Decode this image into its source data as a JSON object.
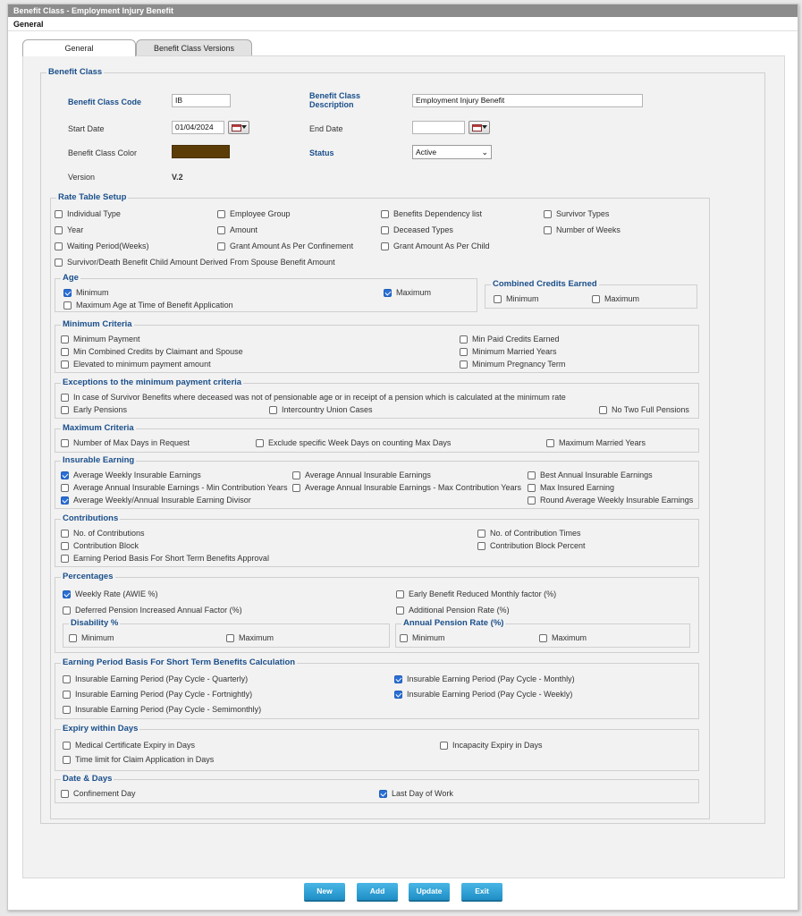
{
  "window": {
    "title": "Benefit Class - Employment Injury Benefit",
    "subtitle": "General"
  },
  "tabs": [
    {
      "label": "General",
      "active": true
    },
    {
      "label": "Benefit Class Versions",
      "active": false
    }
  ],
  "benefit_class": {
    "legend": "Benefit Class",
    "code_label": "Benefit Class Code",
    "code_value": "IB",
    "desc_label": "Benefit Class Description",
    "desc_value": "Employment Injury Benefit",
    "start_label": "Start Date",
    "start_value": "01/04/2024",
    "end_label": "End Date",
    "end_value": "",
    "color_label": "Benefit Class Color",
    "color_value": "#5c3d08",
    "status_label": "Status",
    "status_value": "Active",
    "version_label": "Version",
    "version_value": "V.2"
  },
  "rate_table": {
    "legend": "Rate Table Setup",
    "items": [
      {
        "label": "Individual Type",
        "checked": false
      },
      {
        "label": "Employee Group",
        "checked": false
      },
      {
        "label": "Benefits Dependency list",
        "checked": false
      },
      {
        "label": "Survivor Types",
        "checked": false
      },
      {
        "label": "Year",
        "checked": false
      },
      {
        "label": "Amount",
        "checked": false
      },
      {
        "label": "Deceased Types",
        "checked": false
      },
      {
        "label": "Number of Weeks",
        "checked": false
      },
      {
        "label": "Waiting Period(Weeks)",
        "checked": false
      },
      {
        "label": "Grant Amount As Per Confinement",
        "checked": false
      },
      {
        "label": "Grant Amount As Per Child",
        "checked": false
      },
      {
        "label": "Survivor/Death Benefit Child Amount Derived From Spouse Benefit Amount",
        "checked": false
      }
    ]
  },
  "age": {
    "legend": "Age",
    "items": [
      {
        "label": "Minimum",
        "checked": true
      },
      {
        "label": "Maximum",
        "checked": true
      },
      {
        "label": "Maximum Age at Time of Benefit Application",
        "checked": false
      }
    ]
  },
  "combined_credits": {
    "legend": "Combined Credits Earned",
    "items": [
      {
        "label": "Minimum",
        "checked": false
      },
      {
        "label": "Maximum",
        "checked": false
      }
    ]
  },
  "min_criteria": {
    "legend": "Minimum Criteria",
    "items": [
      {
        "label": "Minimum Payment",
        "checked": false
      },
      {
        "label": "Min Paid Credits Earned",
        "checked": false
      },
      {
        "label": "Min Combined Credits by Claimant and Spouse",
        "checked": false
      },
      {
        "label": "Minimum Married Years",
        "checked": false
      },
      {
        "label": "Elevated to minimum payment amount",
        "checked": false
      },
      {
        "label": "Minimum Pregnancy Term",
        "checked": false
      }
    ]
  },
  "exceptions": {
    "legend": "Exceptions to the minimum payment criteria",
    "items": [
      {
        "label": "In case of Survivor Benefits where deceased was not of pensionable age or in receipt of a pension which is calculated at the minimum rate",
        "checked": false
      },
      {
        "label": "Early Pensions",
        "checked": false
      },
      {
        "label": "Intercountry Union Cases",
        "checked": false
      },
      {
        "label": "No Two Full Pensions",
        "checked": false
      }
    ]
  },
  "max_criteria": {
    "legend": "Maximum Criteria",
    "items": [
      {
        "label": "Number of Max Days in Request",
        "checked": false
      },
      {
        "label": "Exclude specific Week Days on counting Max Days",
        "checked": false
      },
      {
        "label": "Maximum Married Years",
        "checked": false
      }
    ]
  },
  "insurable": {
    "legend": "Insurable Earning",
    "items": [
      {
        "label": "Average Weekly Insurable Earnings",
        "checked": true
      },
      {
        "label": "Average Annual Insurable Earnings",
        "checked": false
      },
      {
        "label": "Best Annual Insurable Earnings",
        "checked": false
      },
      {
        "label": "Average Annual Insurable Earnings - Min Contribution Years",
        "checked": false
      },
      {
        "label": "Average Annual Insurable Earnings - Max Contribution Years",
        "checked": false
      },
      {
        "label": "Max Insured Earning",
        "checked": false
      },
      {
        "label": "Average Weekly/Annual Insurable Earning Divisor",
        "checked": true
      },
      {
        "label": "Round Average Weekly Insurable Earnings",
        "checked": false
      }
    ]
  },
  "contributions": {
    "legend": "Contributions",
    "items": [
      {
        "label": "No. of Contributions",
        "checked": false
      },
      {
        "label": "No. of Contribution Times",
        "checked": false
      },
      {
        "label": "Contribution Block",
        "checked": false
      },
      {
        "label": "Contribution Block Percent",
        "checked": false
      },
      {
        "label": "Earning Period Basis For Short Term Benefits Approval",
        "checked": false
      }
    ]
  },
  "percentages": {
    "legend": "Percentages",
    "items": [
      {
        "label": "Weekly Rate (AWIE %)",
        "checked": true
      },
      {
        "label": "Early Benefit Reduced Monthly factor (%)",
        "checked": false
      },
      {
        "label": "Deferred Pension Increased Annual Factor (%)",
        "checked": false
      },
      {
        "label": "Additional Pension Rate (%)",
        "checked": false
      }
    ],
    "disability": {
      "legend": "Disability %",
      "items": [
        {
          "label": "Minimum",
          "checked": false
        },
        {
          "label": "Maximum",
          "checked": false
        }
      ]
    },
    "annual_pension": {
      "legend": "Annual Pension Rate (%)",
      "items": [
        {
          "label": "Minimum",
          "checked": false
        },
        {
          "label": "Maximum",
          "checked": false
        }
      ]
    }
  },
  "earning_period": {
    "legend": "Earning Period Basis For Short Term Benefits Calculation",
    "items": [
      {
        "label": "Insurable Earning Period (Pay Cycle - Quarterly)",
        "checked": false
      },
      {
        "label": "Insurable Earning Period (Pay Cycle - Monthly)",
        "checked": true
      },
      {
        "label": "Insurable Earning Period (Pay Cycle - Fortnightly)",
        "checked": false
      },
      {
        "label": "Insurable Earning Period (Pay Cycle - Weekly)",
        "checked": true
      },
      {
        "label": "Insurable Earning Period (Pay Cycle - Semimonthly)",
        "checked": false
      }
    ]
  },
  "expiry": {
    "legend": "Expiry within Days",
    "items": [
      {
        "label": "Medical Certificate Expiry in Days",
        "checked": false
      },
      {
        "label": "Incapacity Expiry in Days",
        "checked": false
      },
      {
        "label": "Time limit for Claim Application in Days",
        "checked": false
      }
    ]
  },
  "date_days": {
    "legend": "Date & Days",
    "items": [
      {
        "label": "Confinement Day",
        "checked": false
      },
      {
        "label": "Last Day of Work",
        "checked": true
      }
    ]
  },
  "buttons": {
    "new": "New",
    "add": "Add",
    "update": "Update",
    "exit": "Exit"
  },
  "colors": {
    "legend": "#1a4f8b",
    "checkbox_on": "#2a6fd6",
    "button": "#1e8fc6",
    "titlebar": "#8c8c8c"
  }
}
